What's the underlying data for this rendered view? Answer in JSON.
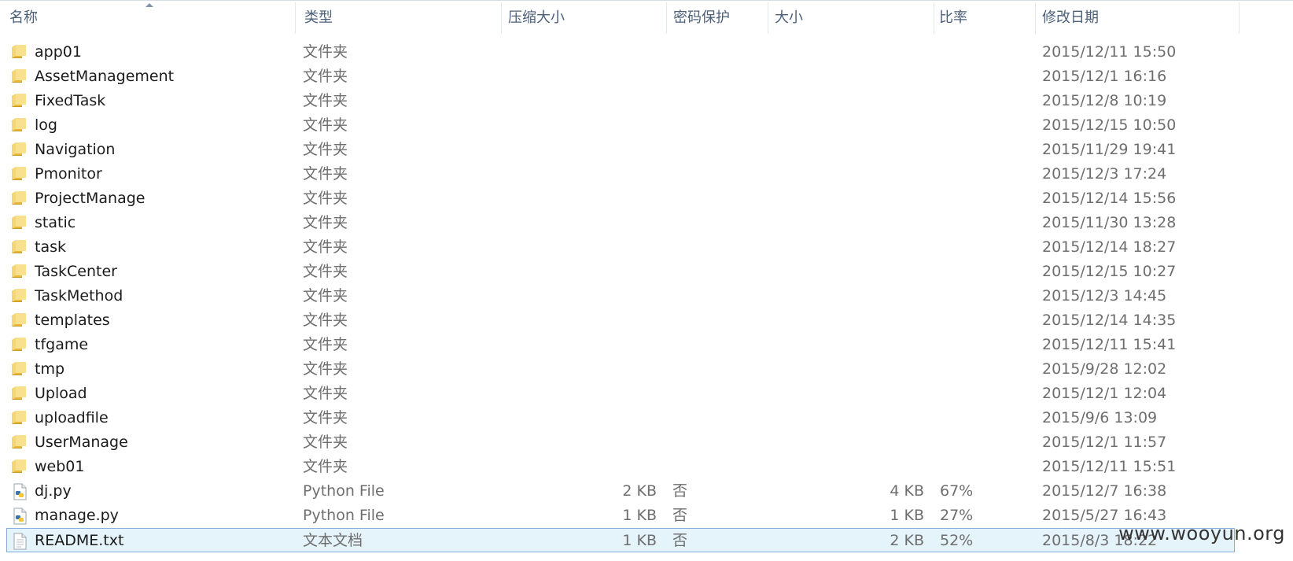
{
  "header": {
    "columns": [
      "名称",
      "类型",
      "压缩大小",
      "密码保护",
      "大小",
      "比率",
      "修改日期"
    ]
  },
  "rows": [
    {
      "icon": "folder-icon",
      "name": "app01",
      "type": "文件夹",
      "csize": "",
      "encrypted": "",
      "size": "",
      "ratio": "",
      "date": "2015/12/11 15:50"
    },
    {
      "icon": "folder-icon",
      "name": "AssetManagement",
      "type": "文件夹",
      "csize": "",
      "encrypted": "",
      "size": "",
      "ratio": "",
      "date": "2015/12/1 16:16"
    },
    {
      "icon": "folder-icon",
      "name": "FixedTask",
      "type": "文件夹",
      "csize": "",
      "encrypted": "",
      "size": "",
      "ratio": "",
      "date": "2015/12/8 10:19"
    },
    {
      "icon": "folder-icon",
      "name": "log",
      "type": "文件夹",
      "csize": "",
      "encrypted": "",
      "size": "",
      "ratio": "",
      "date": "2015/12/15 10:50"
    },
    {
      "icon": "folder-icon",
      "name": "Navigation",
      "type": "文件夹",
      "csize": "",
      "encrypted": "",
      "size": "",
      "ratio": "",
      "date": "2015/11/29 19:41"
    },
    {
      "icon": "folder-icon",
      "name": "Pmonitor",
      "type": "文件夹",
      "csize": "",
      "encrypted": "",
      "size": "",
      "ratio": "",
      "date": "2015/12/3 17:24"
    },
    {
      "icon": "folder-icon",
      "name": "ProjectManage",
      "type": "文件夹",
      "csize": "",
      "encrypted": "",
      "size": "",
      "ratio": "",
      "date": "2015/12/14 15:56"
    },
    {
      "icon": "folder-icon",
      "name": "static",
      "type": "文件夹",
      "csize": "",
      "encrypted": "",
      "size": "",
      "ratio": "",
      "date": "2015/11/30 13:28"
    },
    {
      "icon": "folder-icon",
      "name": "task",
      "type": "文件夹",
      "csize": "",
      "encrypted": "",
      "size": "",
      "ratio": "",
      "date": "2015/12/14 18:27"
    },
    {
      "icon": "folder-icon",
      "name": "TaskCenter",
      "type": "文件夹",
      "csize": "",
      "encrypted": "",
      "size": "",
      "ratio": "",
      "date": "2015/12/15 10:27"
    },
    {
      "icon": "folder-icon",
      "name": "TaskMethod",
      "type": "文件夹",
      "csize": "",
      "encrypted": "",
      "size": "",
      "ratio": "",
      "date": "2015/12/3 14:45"
    },
    {
      "icon": "folder-icon",
      "name": "templates",
      "type": "文件夹",
      "csize": "",
      "encrypted": "",
      "size": "",
      "ratio": "",
      "date": "2015/12/14 14:35"
    },
    {
      "icon": "folder-icon",
      "name": "tfgame",
      "type": "文件夹",
      "csize": "",
      "encrypted": "",
      "size": "",
      "ratio": "",
      "date": "2015/12/11 15:41"
    },
    {
      "icon": "folder-icon",
      "name": "tmp",
      "type": "文件夹",
      "csize": "",
      "encrypted": "",
      "size": "",
      "ratio": "",
      "date": "2015/9/28 12:02"
    },
    {
      "icon": "folder-icon",
      "name": "Upload",
      "type": "文件夹",
      "csize": "",
      "encrypted": "",
      "size": "",
      "ratio": "",
      "date": "2015/12/1 12:04"
    },
    {
      "icon": "folder-icon",
      "name": "uploadfile",
      "type": "文件夹",
      "csize": "",
      "encrypted": "",
      "size": "",
      "ratio": "",
      "date": "2015/9/6 13:09"
    },
    {
      "icon": "folder-icon",
      "name": "UserManage",
      "type": "文件夹",
      "csize": "",
      "encrypted": "",
      "size": "",
      "ratio": "",
      "date": "2015/12/1 11:57"
    },
    {
      "icon": "folder-icon",
      "name": "web01",
      "type": "文件夹",
      "csize": "",
      "encrypted": "",
      "size": "",
      "ratio": "",
      "date": "2015/12/11 15:51"
    },
    {
      "icon": "python-file-icon",
      "name": "dj.py",
      "type": "Python File",
      "csize": "2 KB",
      "encrypted": "否",
      "size": "4 KB",
      "ratio": "67%",
      "date": "2015/12/7 16:38"
    },
    {
      "icon": "python-file-icon",
      "name": "manage.py",
      "type": "Python File",
      "csize": "1 KB",
      "encrypted": "否",
      "size": "1 KB",
      "ratio": "27%",
      "date": "2015/5/27 16:43"
    },
    {
      "icon": "text-file-icon",
      "name": "README.txt",
      "type": "文本文档",
      "csize": "1 KB",
      "encrypted": "否",
      "size": "2 KB",
      "ratio": "52%",
      "date": "2015/8/3 18:22",
      "selected": true
    }
  ],
  "watermark": "www.wooyun.org"
}
